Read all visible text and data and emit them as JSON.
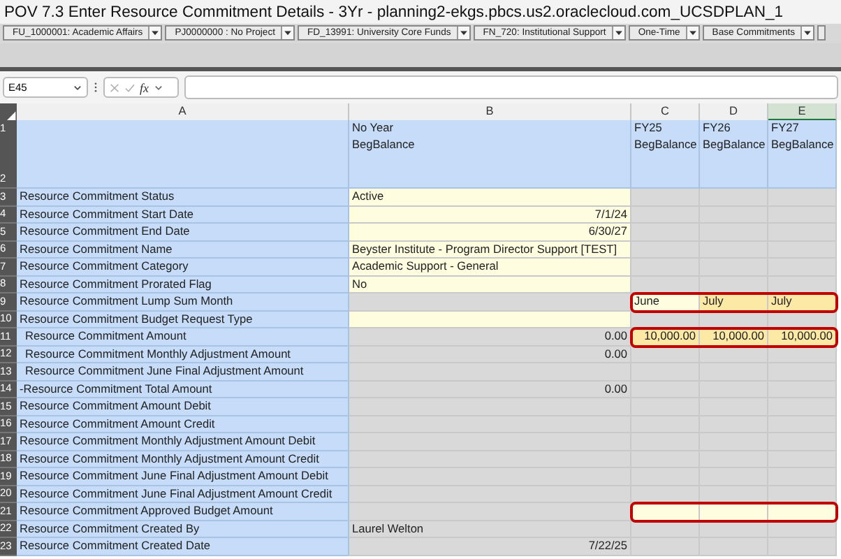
{
  "window": {
    "title": "POV 7.3 Enter Resource Commitment Details - 3Yr - planning2-ekgs.pbcs.us2.oraclecloud.com_UCSDPLAN_1"
  },
  "pov": [
    "FU_1000001: Academic Affairs",
    "PJ0000000 : No Project",
    "FD_13991: University Core Funds",
    "FN_720: Institutional Support",
    "One-Time",
    "Base Commitments"
  ],
  "formula_bar": {
    "name_box": "E45",
    "function_label": "fx"
  },
  "columns": [
    {
      "label": "A",
      "selected": false
    },
    {
      "label": "B",
      "selected": false
    },
    {
      "label": "C",
      "selected": false
    },
    {
      "label": "D",
      "selected": false
    },
    {
      "label": "E",
      "selected": true
    }
  ],
  "rows": [
    {
      "number": "1",
      "kind": "header",
      "cells": [
        {
          "kind": "label"
        },
        {
          "text": "No Year",
          "kind": "label"
        },
        {
          "text": "FY25",
          "kind": "label"
        },
        {
          "text": "FY26",
          "kind": "label"
        },
        {
          "text": "FY27",
          "kind": "label"
        }
      ]
    },
    {
      "number": "2",
      "kind": "header-tall",
      "cells": [
        {
          "kind": "label"
        },
        {
          "text": "BegBalance",
          "kind": "label"
        },
        {
          "text": "BegBalance",
          "kind": "label"
        },
        {
          "text": "BegBalance",
          "kind": "label"
        },
        {
          "text": "BegBalance",
          "kind": "label"
        }
      ]
    },
    {
      "number": "3",
      "kind": "data",
      "cells": [
        {
          "text": "Resource Commitment Status",
          "kind": "label"
        },
        {
          "text": "Active",
          "kind": "input"
        },
        {
          "kind": "locked"
        },
        {
          "kind": "locked"
        },
        {
          "kind": "locked"
        }
      ]
    },
    {
      "number": "4",
      "kind": "data",
      "cells": [
        {
          "text": "Resource Commitment Start Date",
          "kind": "label"
        },
        {
          "text": "7/1/24",
          "kind": "input",
          "right_aligned": true
        },
        {
          "kind": "locked"
        },
        {
          "kind": "locked"
        },
        {
          "kind": "locked"
        }
      ]
    },
    {
      "number": "5",
      "kind": "data",
      "cells": [
        {
          "text": "Resource Commitment End Date",
          "kind": "label"
        },
        {
          "text": "6/30/27",
          "kind": "input",
          "right_aligned": true
        },
        {
          "kind": "locked"
        },
        {
          "kind": "locked"
        },
        {
          "kind": "locked"
        }
      ]
    },
    {
      "number": "6",
      "kind": "data",
      "cells": [
        {
          "text": "Resource Commitment Name",
          "kind": "label"
        },
        {
          "text": "Beyster Institute - Program Director Support [TEST]",
          "kind": "input"
        },
        {
          "kind": "locked"
        },
        {
          "kind": "locked"
        },
        {
          "kind": "locked"
        }
      ]
    },
    {
      "number": "7",
      "kind": "data",
      "cells": [
        {
          "text": "Resource Commitment Category",
          "kind": "label"
        },
        {
          "text": "Academic Support - General",
          "kind": "input"
        },
        {
          "kind": "locked"
        },
        {
          "kind": "locked"
        },
        {
          "kind": "locked"
        }
      ]
    },
    {
      "number": "8",
      "kind": "data",
      "cells": [
        {
          "text": "Resource Commitment Prorated Flag",
          "kind": "label"
        },
        {
          "text": "No",
          "kind": "input"
        },
        {
          "kind": "locked"
        },
        {
          "kind": "locked"
        },
        {
          "kind": "locked"
        }
      ]
    },
    {
      "number": "9",
      "kind": "data",
      "highlighted": true,
      "cells": [
        {
          "text": "Resource Commitment Lump Sum Month",
          "kind": "label"
        },
        {
          "kind": "locked"
        },
        {
          "text": "June",
          "kind": "input"
        },
        {
          "text": "July",
          "kind": "edited"
        },
        {
          "text": "July",
          "kind": "edited"
        }
      ]
    },
    {
      "number": "10",
      "kind": "data",
      "cells": [
        {
          "text": "Resource Commitment Budget Request Type",
          "kind": "label"
        },
        {
          "kind": "input"
        },
        {
          "kind": "locked"
        },
        {
          "kind": "locked"
        },
        {
          "kind": "locked"
        }
      ]
    },
    {
      "number": "11",
      "kind": "data",
      "indent": true,
      "highlighted": true,
      "cells": [
        {
          "text": "Resource Commitment Amount",
          "kind": "label"
        },
        {
          "text": "0.00",
          "kind": "locked",
          "right_aligned": true
        },
        {
          "text": "10,000.00",
          "kind": "edited",
          "right_aligned": true
        },
        {
          "text": "10,000.00",
          "kind": "edited",
          "right_aligned": true
        },
        {
          "text": "10,000.00",
          "kind": "edited",
          "right_aligned": true
        }
      ]
    },
    {
      "number": "12",
      "kind": "data",
      "indent": true,
      "cells": [
        {
          "text": "Resource Commitment Monthly Adjustment Amount",
          "kind": "label"
        },
        {
          "text": "0.00",
          "kind": "locked",
          "right_aligned": true
        },
        {
          "kind": "locked"
        },
        {
          "kind": "locked"
        },
        {
          "kind": "locked"
        }
      ]
    },
    {
      "number": "13",
      "kind": "data",
      "indent": true,
      "cells": [
        {
          "text": "Resource Commitment June Final Adjustment Amount",
          "kind": "label"
        },
        {
          "kind": "locked"
        },
        {
          "kind": "locked"
        },
        {
          "kind": "locked"
        },
        {
          "kind": "locked"
        }
      ]
    },
    {
      "number": "14",
      "kind": "data",
      "cells": [
        {
          "text": "-Resource Commitment Total Amount",
          "kind": "label"
        },
        {
          "text": "0.00",
          "kind": "locked",
          "right_aligned": true
        },
        {
          "kind": "locked"
        },
        {
          "kind": "locked"
        },
        {
          "kind": "locked"
        }
      ]
    },
    {
      "number": "15",
      "kind": "data",
      "cells": [
        {
          "text": "Resource Commitment Amount Debit",
          "kind": "label"
        },
        {
          "kind": "locked"
        },
        {
          "kind": "locked"
        },
        {
          "kind": "locked"
        },
        {
          "kind": "locked"
        }
      ]
    },
    {
      "number": "16",
      "kind": "data",
      "cells": [
        {
          "text": "Resource Commitment Amount Credit",
          "kind": "label"
        },
        {
          "kind": "locked"
        },
        {
          "kind": "locked"
        },
        {
          "kind": "locked"
        },
        {
          "kind": "locked"
        }
      ]
    },
    {
      "number": "17",
      "kind": "data",
      "cells": [
        {
          "text": "Resource Commitment Monthly Adjustment Amount Debit",
          "kind": "label"
        },
        {
          "kind": "locked"
        },
        {
          "kind": "locked"
        },
        {
          "kind": "locked"
        },
        {
          "kind": "locked"
        }
      ]
    },
    {
      "number": "18",
      "kind": "data",
      "cells": [
        {
          "text": "Resource Commitment Monthly Adjustment Amount Credit",
          "kind": "label"
        },
        {
          "kind": "locked"
        },
        {
          "kind": "locked"
        },
        {
          "kind": "locked"
        },
        {
          "kind": "locked"
        }
      ]
    },
    {
      "number": "19",
      "kind": "data",
      "cells": [
        {
          "text": "Resource Commitment June Final Adjustment Amount Debit",
          "kind": "label"
        },
        {
          "kind": "locked"
        },
        {
          "kind": "locked"
        },
        {
          "kind": "locked"
        },
        {
          "kind": "locked"
        }
      ]
    },
    {
      "number": "20",
      "kind": "data",
      "cells": [
        {
          "text": "Resource Commitment June Final Adjustment Amount Credit",
          "kind": "label"
        },
        {
          "kind": "locked"
        },
        {
          "kind": "locked"
        },
        {
          "kind": "locked"
        },
        {
          "kind": "locked"
        }
      ]
    },
    {
      "number": "21",
      "kind": "data",
      "highlighted": true,
      "cells": [
        {
          "text": "Resource Commitment Approved Budget Amount",
          "kind": "label"
        },
        {
          "kind": "locked"
        },
        {
          "kind": "input"
        },
        {
          "kind": "input"
        },
        {
          "kind": "input"
        }
      ]
    },
    {
      "number": "22",
      "kind": "data",
      "cells": [
        {
          "text": "Resource Commitment Created By",
          "kind": "label"
        },
        {
          "text": "Laurel Welton",
          "kind": "locked"
        },
        {
          "kind": "locked"
        },
        {
          "kind": "locked"
        },
        {
          "kind": "locked"
        }
      ]
    },
    {
      "number": "23",
      "kind": "data",
      "cells": [
        {
          "text": "Resource Commitment Created Date",
          "kind": "label"
        },
        {
          "text": "7/22/25",
          "kind": "locked",
          "right_aligned": true
        },
        {
          "kind": "locked"
        },
        {
          "kind": "locked"
        },
        {
          "kind": "locked"
        }
      ]
    }
  ]
}
